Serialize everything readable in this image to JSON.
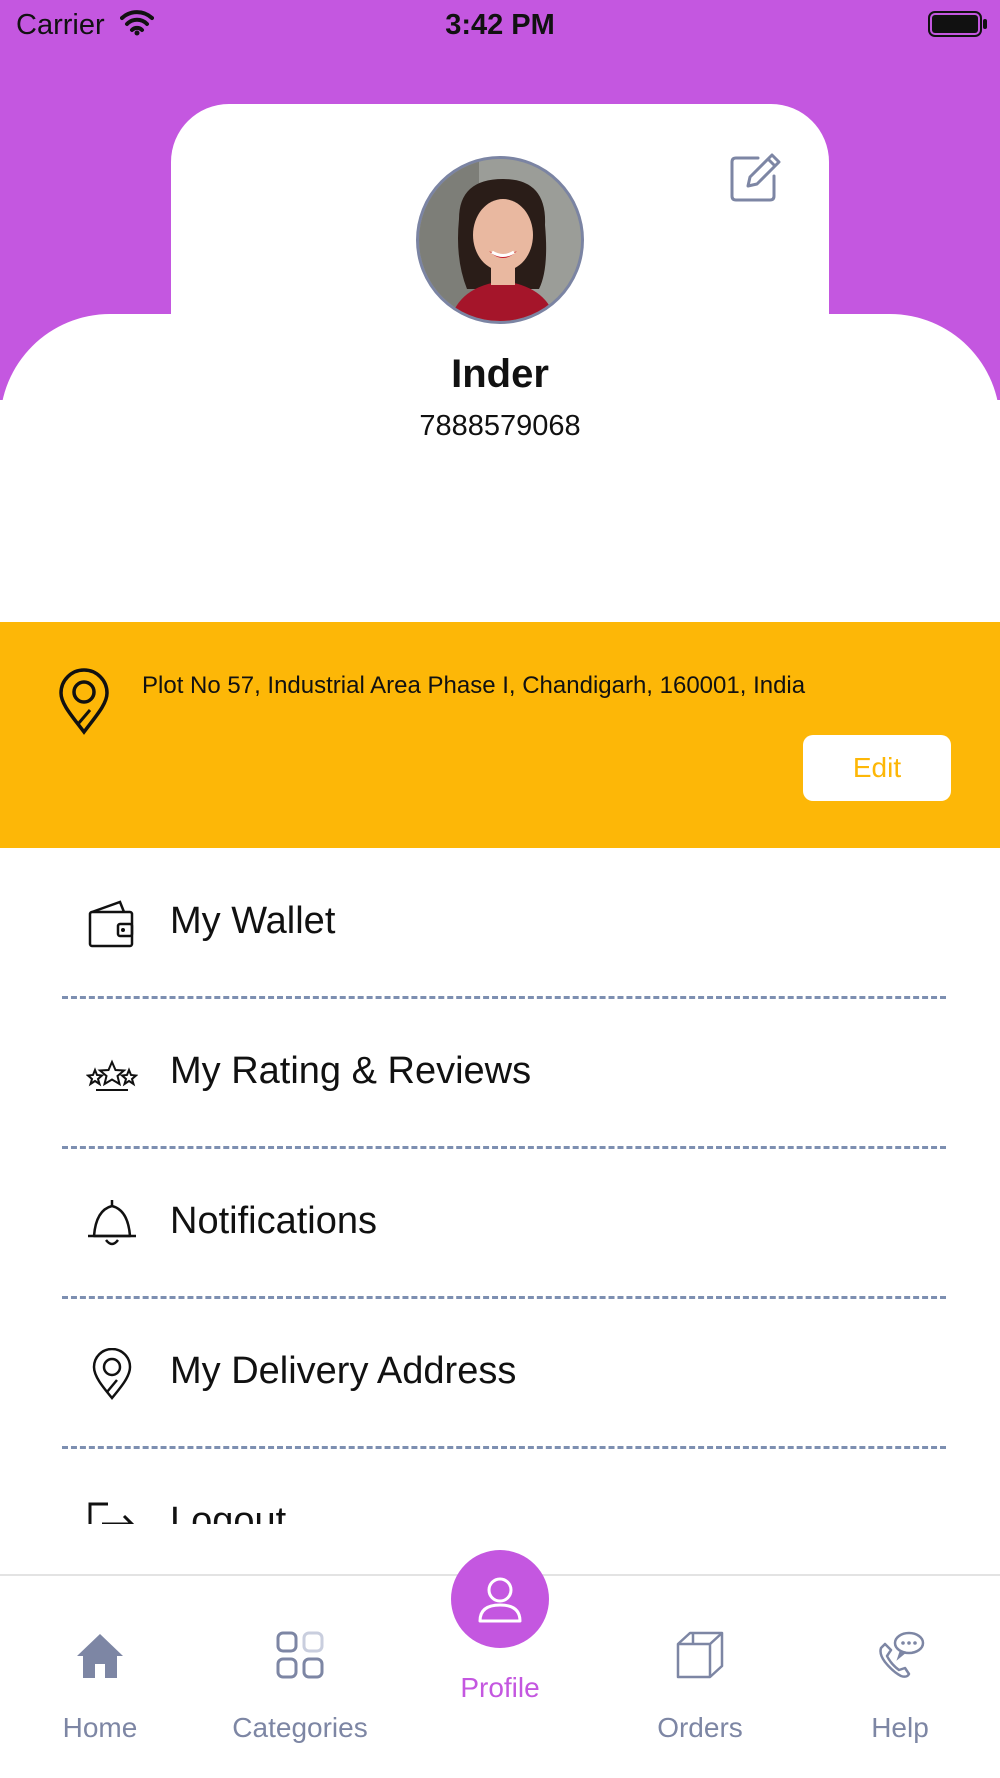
{
  "status_bar": {
    "carrier": "Carrier",
    "time": "3:42 PM",
    "icons": [
      "wifi-icon",
      "battery-icon"
    ]
  },
  "profile": {
    "name": "Inder",
    "phone": "7888579068",
    "avatar": "woman-smiling-photo",
    "edit_icon": "edit-icon"
  },
  "address": {
    "text": "Plot No 57, Industrial Area Phase I, Chandigarh, 160001, India",
    "edit_label": "Edit",
    "icon": "location-pin-icon"
  },
  "menu": {
    "items": [
      {
        "label": "My Wallet",
        "icon": "wallet-icon"
      },
      {
        "label": "My Rating & Reviews",
        "icon": "stars-icon"
      },
      {
        "label": "Notifications",
        "icon": "bell-icon"
      },
      {
        "label": "My Delivery Address",
        "icon": "location-pin-icon"
      },
      {
        "label": "Logout",
        "icon": "logout-icon"
      }
    ]
  },
  "tab_bar": {
    "tabs": [
      {
        "label": "Home",
        "icon": "home-icon",
        "active": false
      },
      {
        "label": "Categories",
        "icon": "grid-icon",
        "active": false
      },
      {
        "label": "Profile",
        "icon": "user-icon",
        "active": true
      },
      {
        "label": "Orders",
        "icon": "box-icon",
        "active": false
      },
      {
        "label": "Help",
        "icon": "phone-chat-icon",
        "active": false
      }
    ]
  },
  "colors": {
    "accent": "#c457e0",
    "banner": "#fdb707",
    "tab_inactive": "#7d86a4",
    "divider": "#7d8fb1"
  }
}
